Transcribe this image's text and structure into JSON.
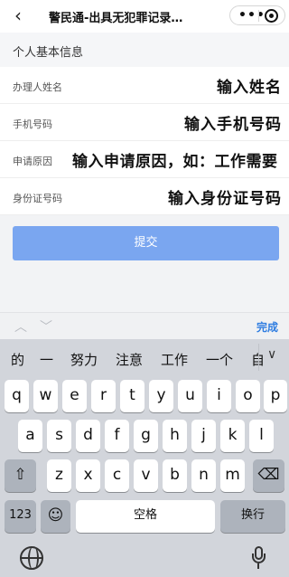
{
  "header": {
    "back_label": "‹",
    "title": "警民通-出具无犯罪记录…",
    "more_label": "•••"
  },
  "section": {
    "title": "个人基本信息"
  },
  "form": {
    "fields": [
      {
        "label": "办理人姓名",
        "value": "输入姓名"
      },
      {
        "label": "手机号码",
        "value": "输入手机号码"
      },
      {
        "label": "申请原因",
        "value": "输入申请原因，如：工作需要"
      },
      {
        "label": "身份证号码",
        "value": "输入身份证号码"
      }
    ],
    "submit_label": "提交"
  },
  "accessory": {
    "up": "︿",
    "down": "﹀",
    "done_label": "完成"
  },
  "keyboard": {
    "suggestions": [
      "的",
      "一",
      "努力",
      "注意",
      "工作",
      "一个",
      "自"
    ],
    "suggestion_toggle": "∨",
    "row1": [
      "q",
      "w",
      "e",
      "r",
      "t",
      "y",
      "u",
      "i",
      "o",
      "p"
    ],
    "row2": [
      "a",
      "s",
      "d",
      "f",
      "g",
      "h",
      "j",
      "k",
      "l"
    ],
    "row3": [
      "z",
      "x",
      "c",
      "v",
      "b",
      "n",
      "m"
    ],
    "shift": "⇧",
    "delete": "⌫",
    "numbers": "123",
    "emoji": "☺",
    "space": "空格",
    "return": "换行"
  }
}
